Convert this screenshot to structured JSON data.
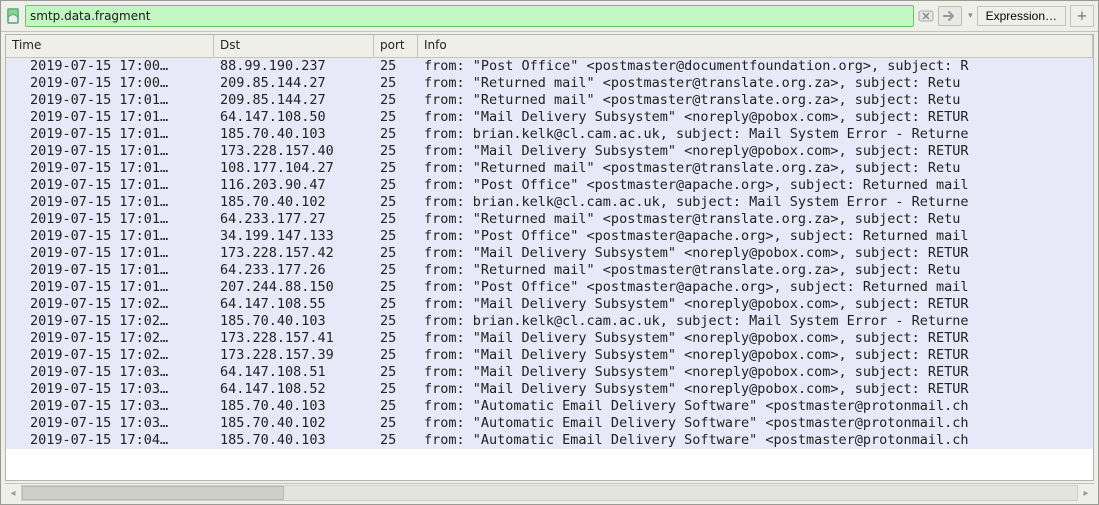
{
  "filter": {
    "value": "smtp.data.fragment",
    "expression_label": "Expression…",
    "plus_label": "+"
  },
  "columns": {
    "time": "Time",
    "dst": "Dst",
    "port": "port",
    "info": "Info"
  },
  "packets": [
    {
      "time": "2019-07-15 17:00…",
      "dst": "88.99.190.237",
      "port": "25",
      "info": "from: \"Post Office\" <postmaster@documentfoundation.org>, subject: R"
    },
    {
      "time": "2019-07-15 17:00…",
      "dst": "209.85.144.27",
      "port": "25",
      "info": "from: \"Returned mail\" <postmaster@translate.org.za>, subject: Retu"
    },
    {
      "time": "2019-07-15 17:01…",
      "dst": "209.85.144.27",
      "port": "25",
      "info": "from: \"Returned mail\" <postmaster@translate.org.za>, subject: Retu"
    },
    {
      "time": "2019-07-15 17:01…",
      "dst": "64.147.108.50",
      "port": "25",
      "info": "from: \"Mail Delivery Subsystem\" <noreply@pobox.com>, subject: RETUR"
    },
    {
      "time": "2019-07-15 17:01…",
      "dst": "185.70.40.103",
      "port": "25",
      "info": "from: brian.kelk@cl.cam.ac.uk, subject: Mail System Error - Returne"
    },
    {
      "time": "2019-07-15 17:01…",
      "dst": "173.228.157.40",
      "port": "25",
      "info": "from: \"Mail Delivery Subsystem\" <noreply@pobox.com>, subject: RETUR"
    },
    {
      "time": "2019-07-15 17:01…",
      "dst": "108.177.104.27",
      "port": "25",
      "info": "from: \"Returned mail\" <postmaster@translate.org.za>, subject: Retu"
    },
    {
      "time": "2019-07-15 17:01…",
      "dst": "116.203.90.47",
      "port": "25",
      "info": "from: \"Post Office\" <postmaster@apache.org>, subject: Returned mail"
    },
    {
      "time": "2019-07-15 17:01…",
      "dst": "185.70.40.102",
      "port": "25",
      "info": "from: brian.kelk@cl.cam.ac.uk, subject: Mail System Error - Returne"
    },
    {
      "time": "2019-07-15 17:01…",
      "dst": "64.233.177.27",
      "port": "25",
      "info": "from: \"Returned mail\" <postmaster@translate.org.za>, subject: Retu"
    },
    {
      "time": "2019-07-15 17:01…",
      "dst": "34.199.147.133",
      "port": "25",
      "info": "from: \"Post Office\" <postmaster@apache.org>, subject: Returned mail"
    },
    {
      "time": "2019-07-15 17:01…",
      "dst": "173.228.157.42",
      "port": "25",
      "info": "from: \"Mail Delivery Subsystem\" <noreply@pobox.com>, subject: RETUR"
    },
    {
      "time": "2019-07-15 17:01…",
      "dst": "64.233.177.26",
      "port": "25",
      "info": "from: \"Returned mail\" <postmaster@translate.org.za>, subject: Retu"
    },
    {
      "time": "2019-07-15 17:01…",
      "dst": "207.244.88.150",
      "port": "25",
      "info": "from: \"Post Office\" <postmaster@apache.org>, subject: Returned mail"
    },
    {
      "time": "2019-07-15 17:02…",
      "dst": "64.147.108.55",
      "port": "25",
      "info": "from: \"Mail Delivery Subsystem\" <noreply@pobox.com>, subject: RETUR"
    },
    {
      "time": "2019-07-15 17:02…",
      "dst": "185.70.40.103",
      "port": "25",
      "info": "from: brian.kelk@cl.cam.ac.uk, subject: Mail System Error - Returne"
    },
    {
      "time": "2019-07-15 17:02…",
      "dst": "173.228.157.41",
      "port": "25",
      "info": "from: \"Mail Delivery Subsystem\" <noreply@pobox.com>, subject: RETUR"
    },
    {
      "time": "2019-07-15 17:02…",
      "dst": "173.228.157.39",
      "port": "25",
      "info": "from: \"Mail Delivery Subsystem\" <noreply@pobox.com>, subject: RETUR"
    },
    {
      "time": "2019-07-15 17:03…",
      "dst": "64.147.108.51",
      "port": "25",
      "info": "from: \"Mail Delivery Subsystem\" <noreply@pobox.com>, subject: RETUR"
    },
    {
      "time": "2019-07-15 17:03…",
      "dst": "64.147.108.52",
      "port": "25",
      "info": "from: \"Mail Delivery Subsystem\" <noreply@pobox.com>, subject: RETUR"
    },
    {
      "time": "2019-07-15 17:03…",
      "dst": "185.70.40.103",
      "port": "25",
      "info": "from: \"Automatic Email Delivery Software\" <postmaster@protonmail.ch"
    },
    {
      "time": "2019-07-15 17:03…",
      "dst": "185.70.40.102",
      "port": "25",
      "info": "from: \"Automatic Email Delivery Software\" <postmaster@protonmail.ch"
    },
    {
      "time": "2019-07-15 17:04…",
      "dst": "185.70.40.103",
      "port": "25",
      "info": "from: \"Automatic Email Delivery Software\" <postmaster@protonmail.ch"
    }
  ]
}
